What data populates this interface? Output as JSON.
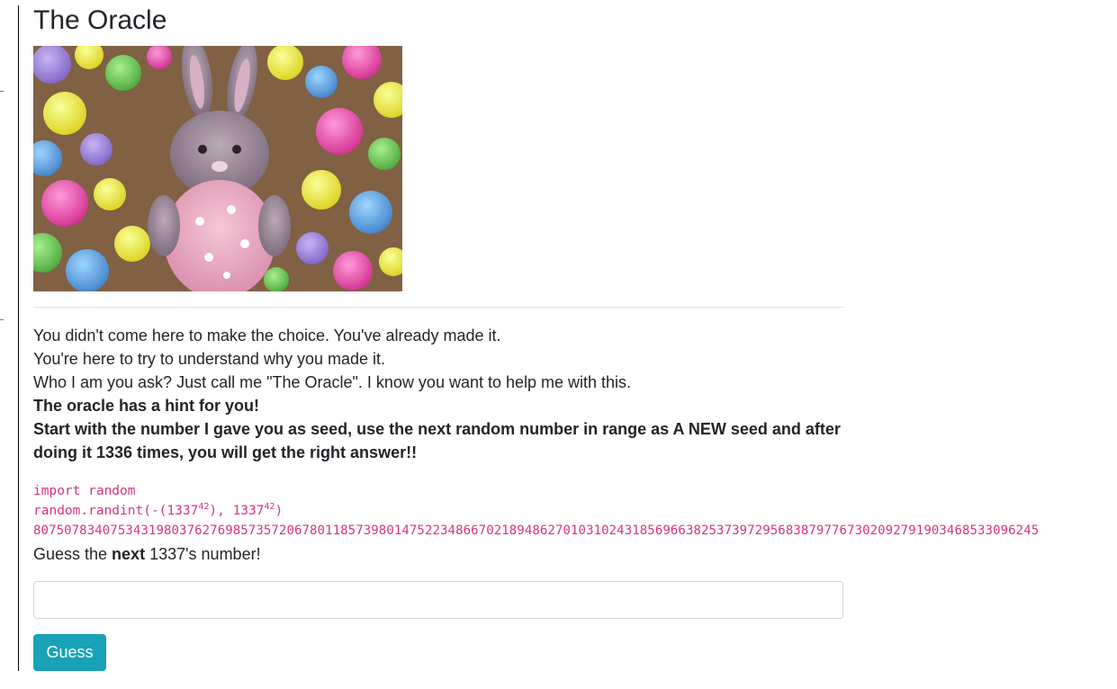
{
  "page": {
    "title": "The Oracle"
  },
  "hero_image": {
    "alt": "plush bunny surrounded by colorful pom-poms"
  },
  "intro": {
    "line1": "You didn't come here to make the choice. You've already made it.",
    "line2": "You're here to try to understand why you made it.",
    "line3": "Who I am you ask? Just call me \"The Oracle\". I know you want to help me with this.",
    "hint_heading": "The oracle has a hint for you!",
    "hint_body": "Start with the number I gave you as seed, use the next random number in range as A NEW seed and after doing it 1336 times, you will get the right answer!!"
  },
  "code": {
    "line1": "import random",
    "line2_prefix": "random.randint(-(1337",
    "line2_exp1": "42",
    "line2_middle": "), 1337",
    "line2_exp2": "42",
    "line2_suffix": ")",
    "seed_number": "8075078340753431980376276985735720678011857398014752234866702189486270103102431856966382537397295683879776730209279190346853309624​5"
  },
  "guess": {
    "prefix": "Guess the ",
    "emphasis": "next",
    "suffix": " 1337's number!",
    "input_value": "",
    "input_placeholder": "",
    "button_label": "Guess"
  },
  "colors": {
    "code_pink": "#d63384",
    "button_teal": "#17a2b8"
  }
}
